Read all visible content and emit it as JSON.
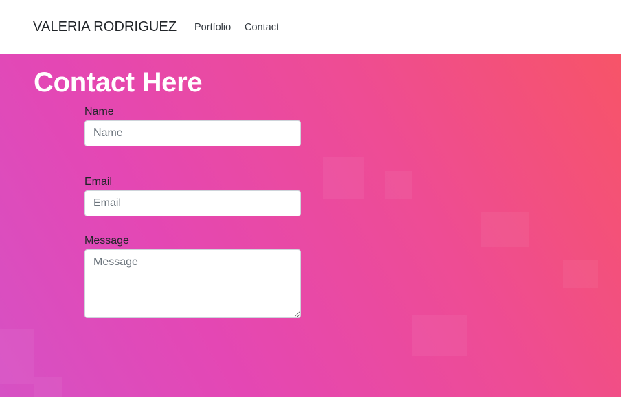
{
  "navbar": {
    "brand": "VALERIA RODRIGUEZ",
    "links": [
      {
        "label": "Portfolio"
      },
      {
        "label": "Contact"
      }
    ]
  },
  "main": {
    "title": "Contact Here",
    "form": {
      "name": {
        "label": "Name",
        "placeholder": "Name",
        "value": ""
      },
      "email": {
        "label": "Email",
        "placeholder": "Email",
        "value": ""
      },
      "message": {
        "label": "Message",
        "placeholder": "Message",
        "value": ""
      }
    }
  },
  "colors": {
    "gradient": [
      "#d651c4",
      "#e447b4",
      "#ee4c94",
      "#f75468"
    ],
    "navbar_background": "#ffffff",
    "title_text": "#ffffff"
  }
}
